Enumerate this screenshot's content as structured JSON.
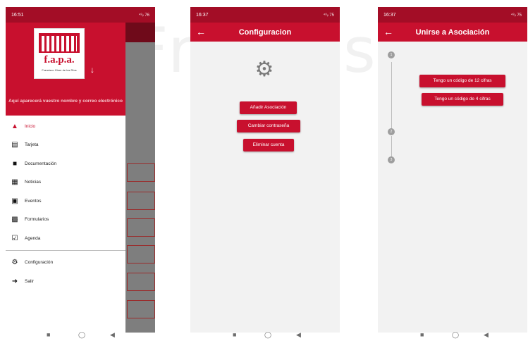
{
  "watermark": "Francisco",
  "screen1": {
    "status_time": "16:51",
    "status_right": "⁴⁸ᵢₗ 76",
    "logo_text": "f.a.p.a.",
    "logo_sub": "Francisco Giner de los Ríos",
    "header_text": "Aquí aparecerá vuestro nombre y correo electrónico",
    "menu": [
      {
        "label": "Inicio",
        "icon": "home-icon",
        "active": true
      },
      {
        "label": "Tarjeta",
        "icon": "id-card-icon"
      },
      {
        "label": "Documentación",
        "icon": "document-icon"
      },
      {
        "label": "Noticias",
        "icon": "newspaper-icon"
      },
      {
        "label": "Eventos",
        "icon": "calendar-icon"
      },
      {
        "label": "Formularios",
        "icon": "form-icon"
      },
      {
        "label": "Agenda",
        "icon": "agenda-icon"
      },
      {
        "label": "Configuración",
        "icon": "gear-icon"
      },
      {
        "label": "Salir",
        "icon": "logout-icon"
      }
    ]
  },
  "screen2": {
    "status_time": "16:37",
    "status_right": "⁴⁸ᵢₗ 75",
    "title": "Configuracion",
    "buttons": {
      "add": "Añadir Asociación",
      "password": "Cambiar contraseña",
      "delete": "Eliminar cuenta"
    }
  },
  "screen3": {
    "status_time": "16:37",
    "status_right": "⁴⁸ᵢₗ 75",
    "title": "Unirse a Asociación",
    "steps": [
      "1",
      "2",
      "3"
    ],
    "buttons": {
      "code12": "Tengo un código de 12 cifras",
      "code4": "Tengo un código de 4 cifras"
    }
  },
  "colors": {
    "primary": "#c8102e",
    "scrim": "#7e7e7e"
  }
}
